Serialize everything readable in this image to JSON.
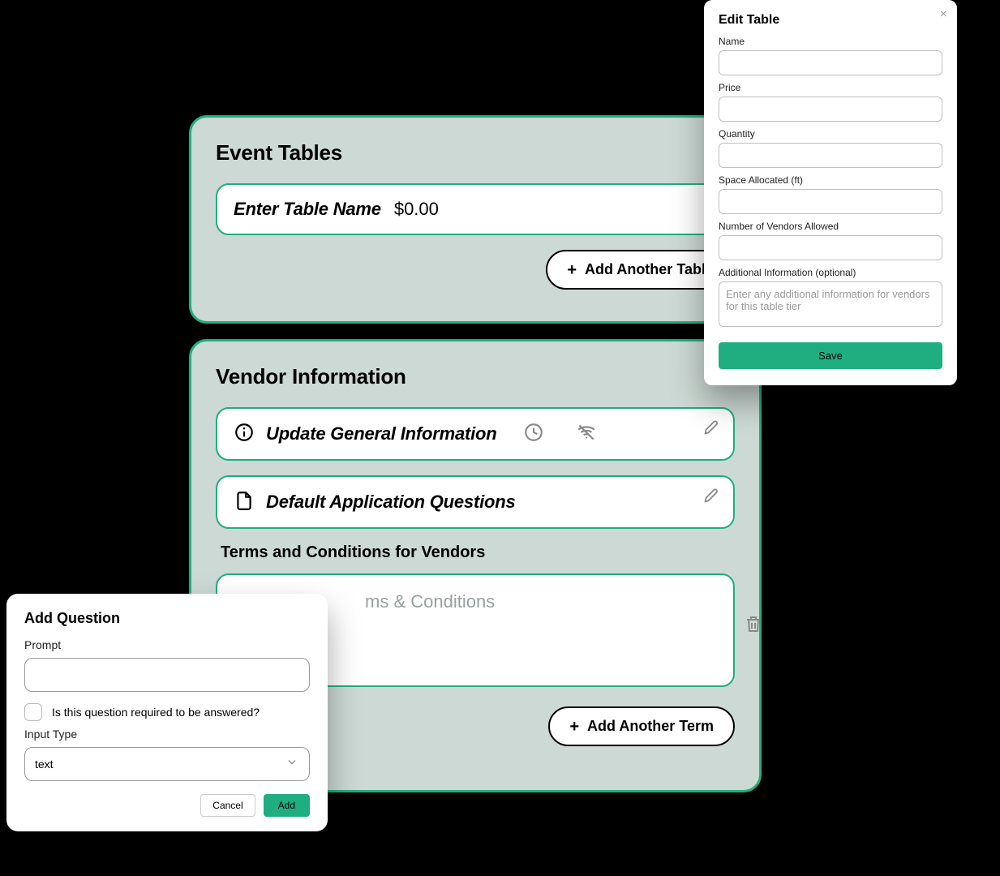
{
  "panels": {
    "event_tables": {
      "title": "Event Tables",
      "row": {
        "name": "Enter Table Name",
        "price": "$0.00"
      },
      "add_btn": "Add Another Table"
    },
    "vendor_info": {
      "title": "Vendor Information",
      "rows": {
        "general": "Update General Information",
        "questions": "Default Application Questions"
      },
      "terms": {
        "heading": "Terms and Conditions for Vendors",
        "placeholder": "ms & Conditions"
      },
      "add_btn": "Add Another Term"
    }
  },
  "modal_edit": {
    "title": "Edit Table",
    "labels": {
      "name": "Name",
      "price": "Price",
      "quantity": "Quantity",
      "space": "Space Allocated (ft)",
      "vendors": "Number of Vendors Allowed",
      "additional": "Additional Information (optional)"
    },
    "additional_placeholder": "Enter any additional information for vendors for this table tier",
    "save": "Save"
  },
  "modal_question": {
    "title": "Add Question",
    "prompt_label": "Prompt",
    "required_label": "Is this question required to be answered?",
    "input_type_label": "Input Type",
    "input_type_value": "text",
    "cancel": "Cancel",
    "add": "Add"
  }
}
